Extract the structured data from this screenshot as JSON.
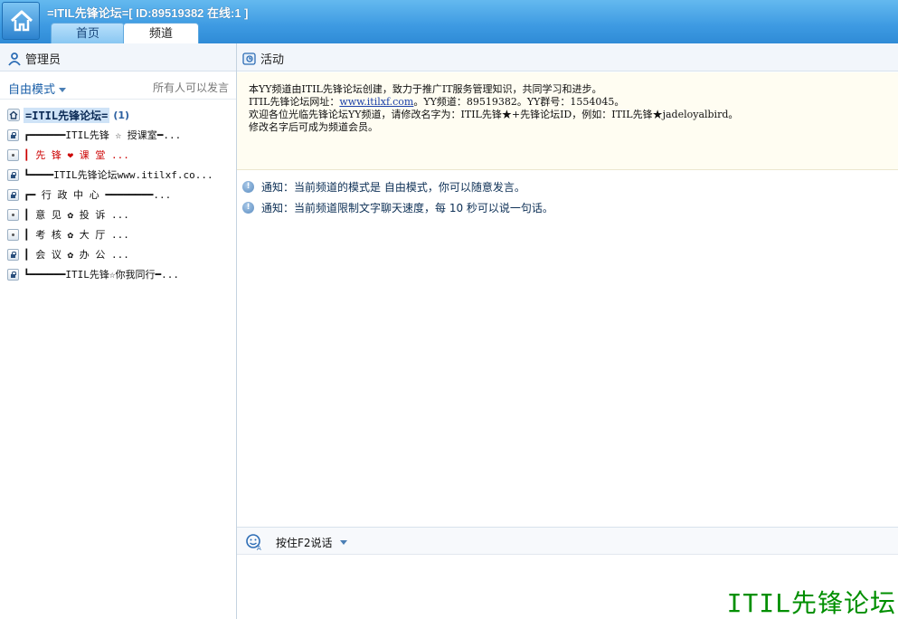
{
  "window": {
    "title": "=ITIL先锋论坛=[ ID:89519382 在线:1 ]",
    "tabs": [
      {
        "label": "首页",
        "active": false
      },
      {
        "label": "频道",
        "active": true
      }
    ]
  },
  "subheader": {
    "left_label": "管理员",
    "right_label": "活动"
  },
  "left_panel": {
    "mode": "自由模式",
    "permission": "所有人可以发言",
    "root": {
      "name": "=ITIL先锋论坛=",
      "count": "(1)"
    },
    "items": [
      {
        "icon": "lock-icon",
        "label": "┏━━━━━━ITIL先锋 ☆ 授课室━...",
        "red": false
      },
      {
        "icon": "dot-icon",
        "label": "┃          先 锋 ❤ 课 堂       ...",
        "red": true
      },
      {
        "icon": "lock-icon",
        "label": "┗━━━━ITIL先锋论坛www.itilxf.co...",
        "red": false
      },
      {
        "icon": "lock-icon",
        "label": "┏━  行 政 中 心 ━━━━━━━━...",
        "red": false
      },
      {
        "icon": "dot-icon",
        "label": "┃          意 见 ✿ 投 诉       ...",
        "red": false
      },
      {
        "icon": "dot-icon",
        "label": "┃          考 核 ✿ 大 厅       ...",
        "red": false
      },
      {
        "icon": "lock-icon",
        "label": "┃          会 议 ✿ 办 公       ...",
        "red": false
      },
      {
        "icon": "lock-icon",
        "label": "┗━━━━━━ITIL先锋☆你我同行━...",
        "red": false
      }
    ]
  },
  "announcement": {
    "line1": "本YY频道由ITIL先锋论坛创建，致力于推广IT服务管理知识，共同学习和进步。",
    "line2_prefix": "ITIL先锋论坛网址：",
    "line2_link": "www.itilxf.com",
    "line2_suffix": "。YY频道：89519382。YY群号：1554045。",
    "line3": "欢迎各位光临先锋论坛YY频道，请修改名字为：ITIL先锋★+先锋论坛ID，例如：ITIL先锋★jadeloyalbird。",
    "line4": "修改名字后可成为频道会员。"
  },
  "chat": {
    "notices": [
      "通知：当前频道的模式是 自由模式，你可以随意发言。",
      "通知：当前频道限制文字聊天速度，每 10 秒可以说一句话。"
    ]
  },
  "input": {
    "speak_label": "按住F2说话"
  },
  "watermark": "ITIL先锋论坛"
}
